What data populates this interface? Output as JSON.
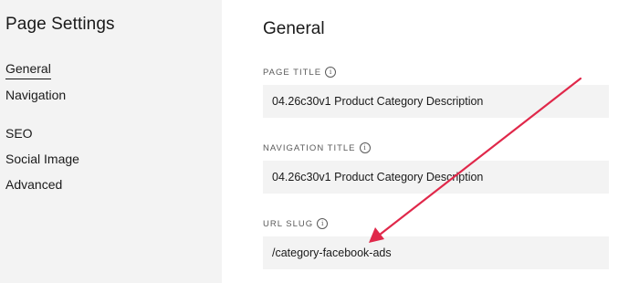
{
  "sidebar": {
    "title": "Page Settings",
    "items": [
      {
        "label": "General",
        "active": true
      },
      {
        "label": "Navigation",
        "active": false
      },
      {
        "label": "SEO",
        "active": false
      },
      {
        "label": "Social Image",
        "active": false
      },
      {
        "label": "Advanced",
        "active": false
      }
    ]
  },
  "main": {
    "section_title": "General",
    "fields": [
      {
        "label": "PAGE TITLE",
        "value": "04.26c30v1 Product Category Description"
      },
      {
        "label": "NAVIGATION TITLE",
        "value": "04.26c30v1 Product Category Description"
      },
      {
        "label": "URL SLUG",
        "value": "/category-facebook-ads"
      }
    ]
  },
  "icons": {
    "info": "info-icon"
  },
  "colors": {
    "sidebar_bg": "#f3f3f3",
    "input_bg": "#f3f3f3",
    "annotation_arrow": "#e0284a"
  }
}
